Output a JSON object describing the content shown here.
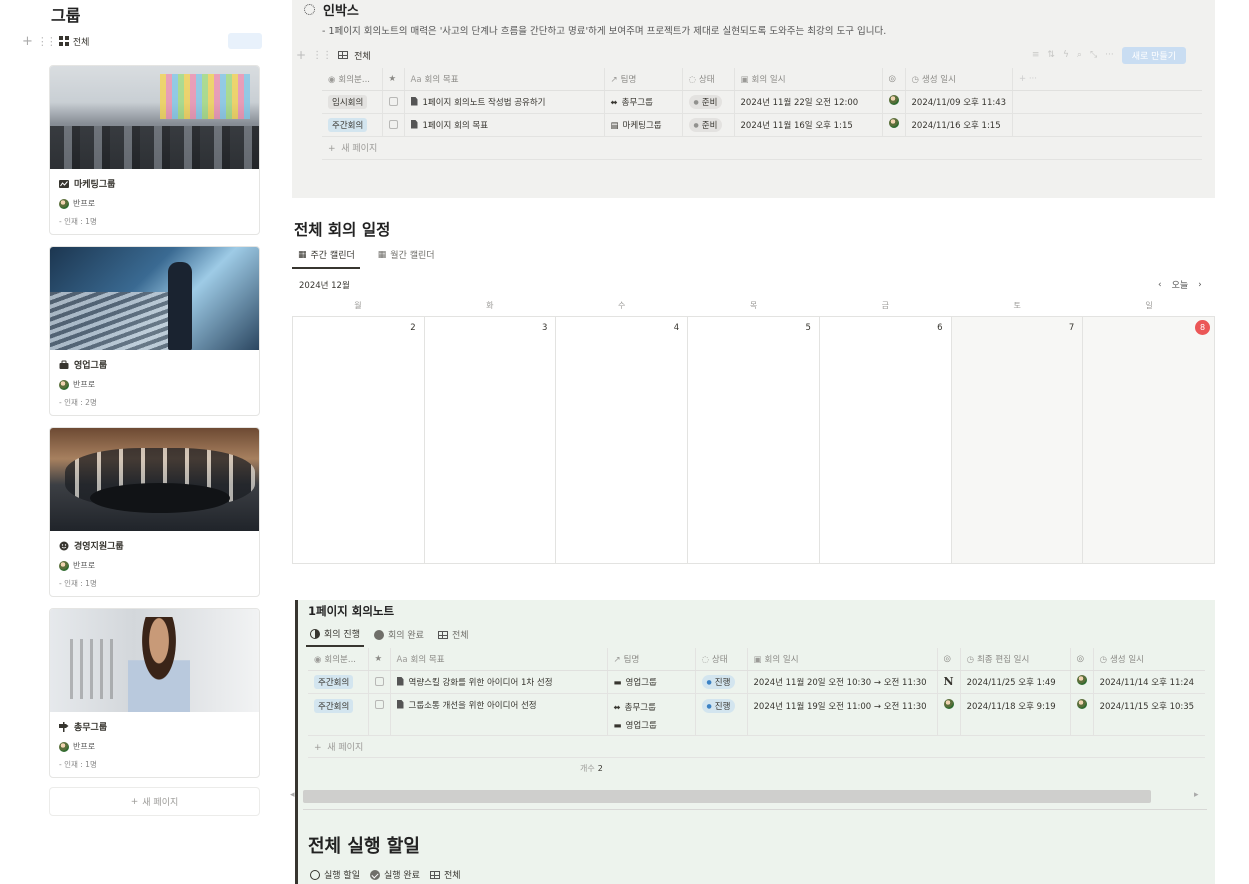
{
  "groups": {
    "title": "그룹",
    "view_label": "전체",
    "new_page": "새 페이지",
    "cards": [
      {
        "name": "마케팅그룹",
        "owner": "반프로",
        "count": "- 인재 : 1명",
        "icon": "chart-icon"
      },
      {
        "name": "영업그룹",
        "owner": "반프로",
        "count": "- 인재 : 2명",
        "icon": "briefcase-icon"
      },
      {
        "name": "경영지원그룹",
        "owner": "반프로",
        "count": "- 인재 : 1명",
        "icon": "smile-icon"
      },
      {
        "name": "총무그룹",
        "owner": "반프로",
        "count": "- 인재 : 1명",
        "icon": "signpost-icon"
      }
    ]
  },
  "inbox": {
    "title": "인박스",
    "description": "- 1페이지 회의노트의 매력은 '사고의 단계나 흐름을 간단하고 명료'하게 보여주며 프로젝트가 제대로 실현되도록 도와주는 최강의 도구 입니다.",
    "view_label": "전체",
    "new_button": "새로 만들기",
    "columns": [
      "회의분...",
      "",
      "회의 목표",
      "팀명",
      "상태",
      "회의 일시",
      "",
      "생성 일시"
    ],
    "rows": [
      {
        "type": "임시회의",
        "goal": "1페이지 회의노트 작성법 공유하기",
        "team": "총무그룹",
        "status": "준비",
        "date": "2024년 11월 22일 오전 12:00",
        "created": "2024/11/09 오후 11:43"
      },
      {
        "type": "주간회의",
        "goal": "1페이지 회의 목표",
        "team": "마케팅그룹",
        "status": "준비",
        "date": "2024년 11월 16일 오후 1:15",
        "created": "2024/11/16 오후 1:15"
      }
    ],
    "new_row": "새 페이지"
  },
  "calendar": {
    "title": "전체 회의 일정",
    "tabs": [
      "주간 캘린더",
      "월간 캘린더"
    ],
    "month": "2024년 12월",
    "today_label": "오늘",
    "weekdays": [
      "월",
      "화",
      "수",
      "목",
      "금",
      "토",
      "일"
    ],
    "dates": [
      "2",
      "3",
      "4",
      "5",
      "6",
      "7",
      "8"
    ]
  },
  "notes": {
    "title": "1페이지 회의노트",
    "tabs": [
      "회의 진행",
      "회의 완료",
      "전체"
    ],
    "columns": [
      "회의분...",
      "",
      "회의 목표",
      "팀명",
      "상태",
      "회의 일시",
      "",
      "최종 편집 일시",
      "",
      "생성 일시"
    ],
    "rows": [
      {
        "type": "주간회의",
        "goal": "역량스킬 강화를 위한 아이디어 1차 선정",
        "teams": [
          "영업그룹"
        ],
        "status": "진행",
        "date": "2024년 11월 20일 오전 10:30 → 오전 11:30",
        "edited": "2024/11/25 오후 1:49",
        "created": "2024/11/14 오후 11:24"
      },
      {
        "type": "주간회의",
        "goal": "그룹소통 개선을 위한 아이디어 선정",
        "teams": [
          "총무그룹",
          "영업그룹"
        ],
        "status": "진행",
        "date": "2024년 11월 19일 오전 11:00 → 오전 11:30",
        "edited": "2024/11/18 오후 9:19",
        "created": "2024/11/15 오후 10:35"
      }
    ],
    "new_row": "새 페이지",
    "count_label": "개수",
    "count_value": "2"
  },
  "todo": {
    "title": "전체 실행 할일",
    "tabs": [
      "실행 할일",
      "실행 완료",
      "전체"
    ]
  },
  "colors": {
    "accent": "#2383e2",
    "today_badge": "#eb5757",
    "inbox_bg": "#f1f1ef",
    "notes_bg": "#edf3ed"
  }
}
